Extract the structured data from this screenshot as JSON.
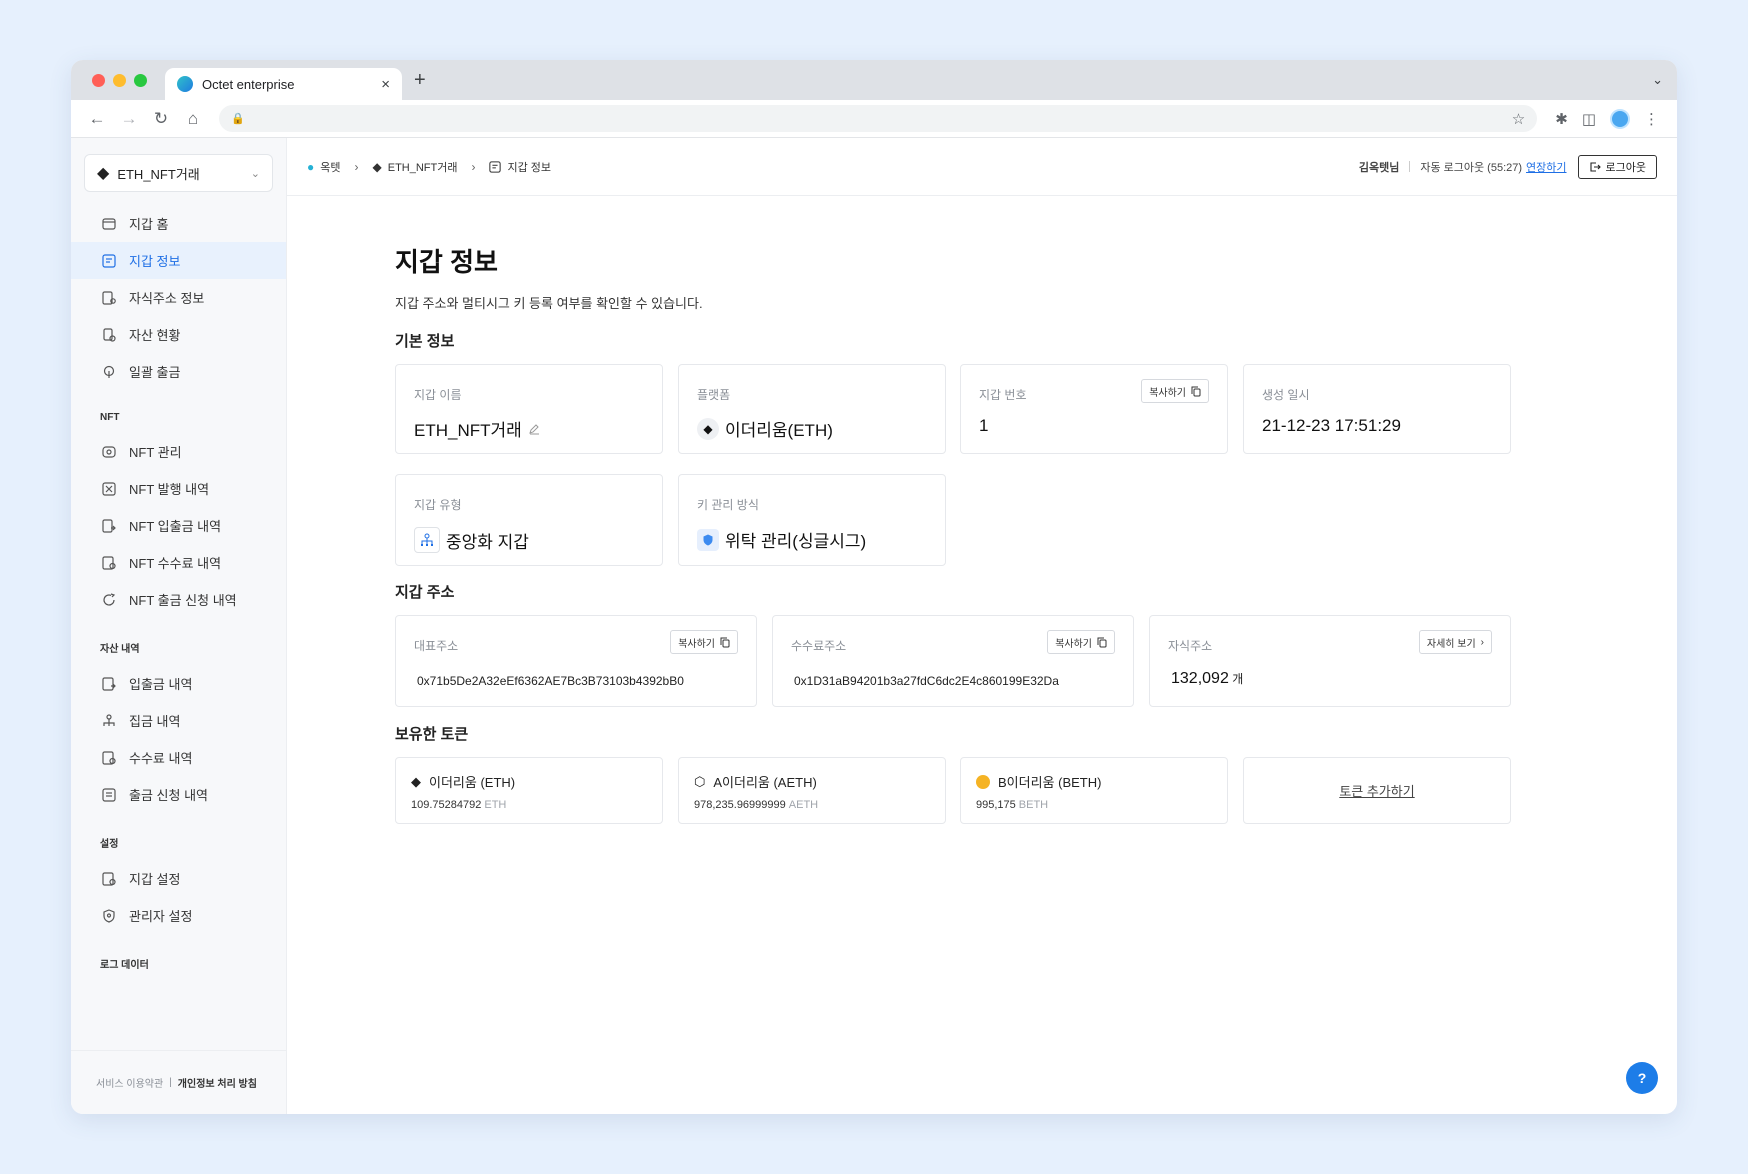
{
  "browser": {
    "tab_title": "Octet enterprise",
    "new_tab": "+",
    "close": "×"
  },
  "sidebar": {
    "wallet_select": "ETH_NFT거래",
    "items_main": [
      {
        "label": "지갑 홈",
        "icon": "wallet-icon"
      },
      {
        "label": "지갑 정보",
        "icon": "wallet-info-icon",
        "active": true
      },
      {
        "label": "자식주소 정보",
        "icon": "child-address-icon"
      },
      {
        "label": "자산 현황",
        "icon": "asset-icon"
      },
      {
        "label": "일괄 출금",
        "icon": "batch-withdraw-icon"
      }
    ],
    "section_nft": "NFT",
    "items_nft": [
      {
        "label": "NFT 관리"
      },
      {
        "label": "NFT 발행 내역"
      },
      {
        "label": "NFT 입출금 내역"
      },
      {
        "label": "NFT 수수료 내역"
      },
      {
        "label": "NFT 출금 신청 내역"
      }
    ],
    "section_assets": "자산 내역",
    "items_assets": [
      {
        "label": "입출금 내역"
      },
      {
        "label": "집금 내역"
      },
      {
        "label": "수수료 내역"
      },
      {
        "label": "출금 신청 내역"
      }
    ],
    "section_settings": "설정",
    "items_settings": [
      {
        "label": "지갑 설정"
      },
      {
        "label": "관리자 설정"
      }
    ],
    "section_log": "로그 데이터",
    "footer_terms": "서비스 이용약관",
    "footer_privacy": "개인정보 처리 방침"
  },
  "topbar": {
    "breadcrumb": [
      "옥텟",
      "ETH_NFT거래",
      "지갑 정보"
    ],
    "user": "김옥텟님",
    "auto_logout": "자동 로그아웃 (55:27)",
    "extend": "연장하기",
    "logout": "로그아웃"
  },
  "page": {
    "title": "지갑 정보",
    "description": "지갑 주소와 멀티시그 키 등록 여부를 확인할 수 있습니다."
  },
  "basic_info": {
    "section_title": "기본 정보",
    "wallet_name_label": "지갑 이름",
    "wallet_name": "ETH_NFT거래",
    "platform_label": "플랫폼",
    "platform": "이더리움(ETH)",
    "wallet_number_label": "지갑 번호",
    "wallet_number": "1",
    "created_label": "생성 일시",
    "created": "21-12-23 17:51:29",
    "wallet_type_label": "지갑 유형",
    "wallet_type": "중앙화 지갑",
    "key_method_label": "키 관리 방식",
    "key_method": "위탁 관리(싱글시그)",
    "copy": "복사하기"
  },
  "address": {
    "section_title": "지갑 주소",
    "main_label": "대표주소",
    "main_value": "0x71b5De2A32eEf6362AE7Bc3B73103b4392bB0",
    "fee_label": "수수료주소",
    "fee_value": "0x1D31aB94201b3a27fdC6dc2E4c860199E32Da",
    "child_label": "자식주소",
    "child_count": "132,092",
    "child_unit": "개",
    "copy": "복사하기",
    "detail": "자세히 보기"
  },
  "tokens": {
    "section_title": "보유한 토큰",
    "items": [
      {
        "name": "이더리움 (ETH)",
        "amount": "109.75284792",
        "unit": "ETH"
      },
      {
        "name": "A이더리움 (AETH)",
        "amount": "978,235.96999999",
        "unit": "AETH"
      },
      {
        "name": "B이더리움 (BETH)",
        "amount": "995,175",
        "unit": "BETH"
      }
    ],
    "add": "토큰 추가하기"
  },
  "help": "?",
  "colors": {
    "accent": "#1f6fe5",
    "active_bg": "#e8f1fd",
    "page_bg": "#e6f0fd"
  }
}
